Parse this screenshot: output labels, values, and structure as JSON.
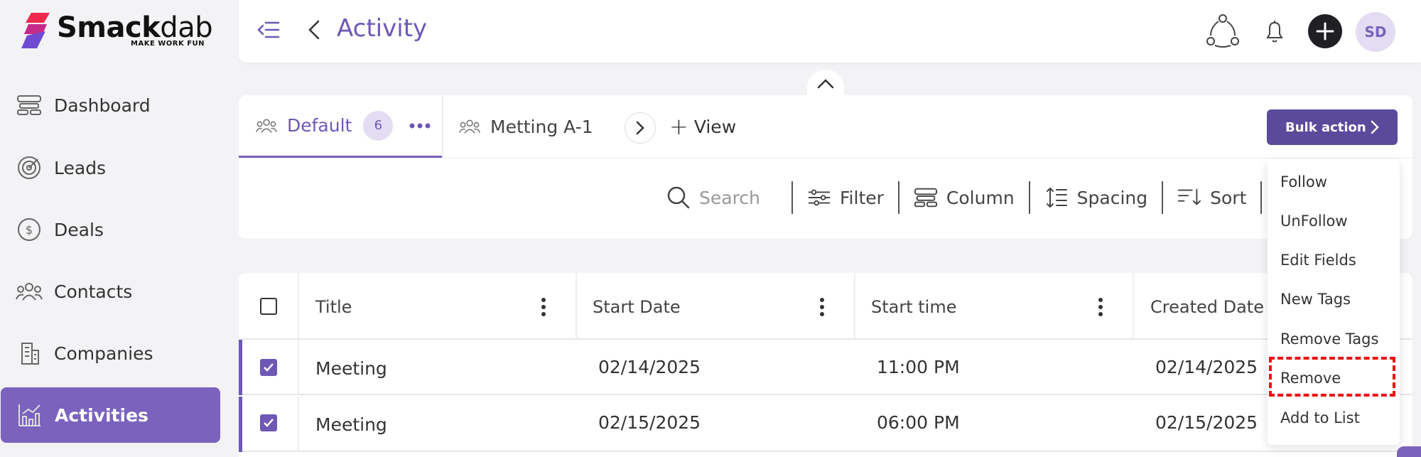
{
  "brand": {
    "name_bold": "Smack",
    "name_light": "dab",
    "tagline": "MAKE WORK FUN"
  },
  "sidebar": {
    "items": [
      {
        "label": "Dashboard",
        "icon": "dashboard-icon",
        "active": false
      },
      {
        "label": "Leads",
        "icon": "target-icon",
        "active": false
      },
      {
        "label": "Deals",
        "icon": "dollar-circle-icon",
        "active": false
      },
      {
        "label": "Contacts",
        "icon": "people-icon",
        "active": false
      },
      {
        "label": "Companies",
        "icon": "building-icon",
        "active": false
      },
      {
        "label": "Activities",
        "icon": "chart-icon",
        "active": true
      }
    ]
  },
  "header": {
    "title": "Activity",
    "avatar_initials": "SD"
  },
  "views": {
    "tabs": [
      {
        "label": "Default",
        "count": "6"
      },
      {
        "label": "Metting A-1"
      }
    ],
    "add_view_label": "View",
    "bulk_action_label": "Bulk action"
  },
  "toolbar": {
    "search_placeholder": "Search",
    "filter_label": "Filter",
    "column_label": "Column",
    "spacing_label": "Spacing",
    "sort_label": "Sort"
  },
  "table": {
    "columns": [
      "Title",
      "Start Date",
      "Start time",
      "Created Date"
    ],
    "rows": [
      {
        "title": "Meeting",
        "start_date": "02/14/2025",
        "start_time": "11:00 PM",
        "created_date": "02/14/2025",
        "checked": true
      },
      {
        "title": "Meeting",
        "start_date": "02/15/2025",
        "start_time": "06:00 PM",
        "created_date": "02/15/2025",
        "checked": true
      }
    ]
  },
  "bulk_menu": {
    "items": [
      "Follow",
      "UnFollow",
      "Edit Fields",
      "New Tags",
      "Remove Tags",
      "Remove",
      "Add to List"
    ],
    "highlighted": "Remove"
  },
  "colors": {
    "accent": "#7a62bd",
    "accent_dark": "#5b4a9c",
    "highlight": "#ee1111"
  }
}
